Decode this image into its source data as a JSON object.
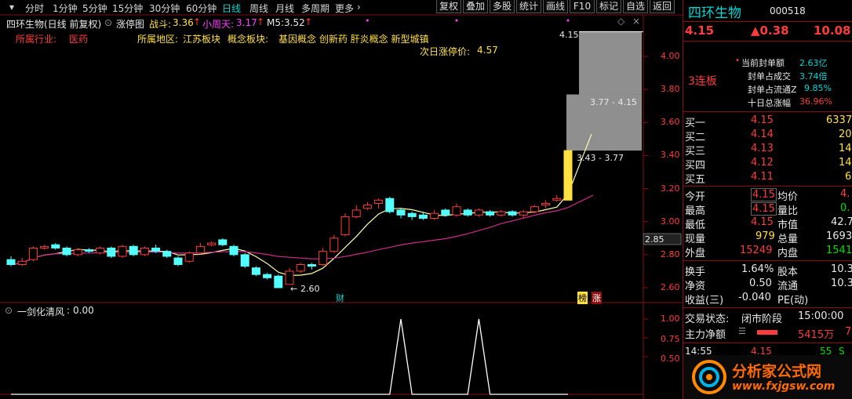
{
  "toolbar": {
    "periods": [
      "分时",
      "1分钟",
      "5分钟",
      "15分钟",
      "30分钟",
      "60分钟",
      "日线",
      "周线",
      "月线",
      "多周期",
      "更多"
    ],
    "active_period": "日线",
    "buttons": [
      "复权",
      "叠加",
      "多股",
      "统计",
      "画线",
      "F10",
      "标记",
      "自选",
      "返回"
    ]
  },
  "info_bar": {
    "stock_title": "四环生物(日线 前复权)",
    "indicator_name": "涨停图",
    "zhandou_label": "战斗:",
    "zhandou_value": "3.36",
    "xiaozhoutian_label": "小周天:",
    "xiaozhoutian_value": "3.17",
    "m5_label": "M5:",
    "m5_value": "3.52"
  },
  "industry": {
    "industry_label": "所属行业:",
    "industry_value": "医药",
    "region_label": "所属地区:",
    "region_value": "江苏板块",
    "concept_label": "概念板块:",
    "concept_value": "基因概念 创新药 肝炎概念 新型城镇",
    "next_limit_label": "次日涨停价:",
    "next_limit_value": "4.57"
  },
  "main_chart": {
    "y_ticks": [
      "4.00",
      "3.80",
      "3.60",
      "3.40",
      "3.20",
      "3.00",
      "2.80",
      "2.60"
    ],
    "price_marker": "2.85",
    "high_label": "4.15",
    "box_upper_label": "3.77 - 4.15",
    "box_lower_label": "3.43 - 3.77",
    "low_label": "2.60",
    "cai_label": "财",
    "bang_label": "榜",
    "zhang_label": "涨",
    "colors": {
      "up": "#ff3c3c",
      "down": "#54ffff",
      "ma_yellow": "#ffffaa",
      "ma_pink": "#d02a8c",
      "box": "#8f8f8f"
    },
    "candles": [
      {
        "o": 2.77,
        "c": 2.74,
        "h": 2.79,
        "l": 2.73
      },
      {
        "o": 2.74,
        "c": 2.76,
        "h": 2.78,
        "l": 2.73
      },
      {
        "o": 2.77,
        "c": 2.84,
        "h": 2.85,
        "l": 2.76
      },
      {
        "o": 2.84,
        "c": 2.85,
        "h": 2.86,
        "l": 2.83
      },
      {
        "o": 2.86,
        "c": 2.84,
        "h": 2.87,
        "l": 2.83
      },
      {
        "o": 2.84,
        "c": 2.8,
        "h": 2.85,
        "l": 2.79
      },
      {
        "o": 2.8,
        "c": 2.83,
        "h": 2.84,
        "l": 2.79
      },
      {
        "o": 2.83,
        "c": 2.82,
        "h": 2.84,
        "l": 2.81
      },
      {
        "o": 2.81,
        "c": 2.84,
        "h": 2.85,
        "l": 2.8
      },
      {
        "o": 2.84,
        "c": 2.79,
        "h": 2.85,
        "l": 2.78
      },
      {
        "o": 2.79,
        "c": 2.85,
        "h": 2.86,
        "l": 2.78
      },
      {
        "o": 2.85,
        "c": 2.8,
        "h": 2.86,
        "l": 2.79
      },
      {
        "o": 2.8,
        "c": 2.84,
        "h": 2.85,
        "l": 2.79
      },
      {
        "o": 2.84,
        "c": 2.82,
        "h": 2.86,
        "l": 2.81
      },
      {
        "o": 2.82,
        "c": 2.79,
        "h": 2.83,
        "l": 2.78
      },
      {
        "o": 2.78,
        "c": 2.74,
        "h": 2.79,
        "l": 2.73
      },
      {
        "o": 2.76,
        "c": 2.81,
        "h": 2.82,
        "l": 2.75
      },
      {
        "o": 2.81,
        "c": 2.85,
        "h": 2.87,
        "l": 2.8
      },
      {
        "o": 2.86,
        "c": 2.87,
        "h": 2.88,
        "l": 2.85
      },
      {
        "o": 2.89,
        "c": 2.86,
        "h": 2.9,
        "l": 2.85
      },
      {
        "o": 2.85,
        "c": 2.8,
        "h": 2.86,
        "l": 2.79
      },
      {
        "o": 2.8,
        "c": 2.73,
        "h": 2.81,
        "l": 2.72
      },
      {
        "o": 2.72,
        "c": 2.68,
        "h": 2.73,
        "l": 2.67
      },
      {
        "o": 2.68,
        "c": 2.66,
        "h": 2.69,
        "l": 2.65
      },
      {
        "o": 2.67,
        "c": 2.6,
        "h": 2.68,
        "l": 2.6
      },
      {
        "o": 2.62,
        "c": 2.7,
        "h": 2.72,
        "l": 2.62
      },
      {
        "o": 2.7,
        "c": 2.74,
        "h": 2.75,
        "l": 2.69
      },
      {
        "o": 2.74,
        "c": 2.73,
        "h": 2.75,
        "l": 2.71
      },
      {
        "o": 2.74,
        "c": 2.82,
        "h": 2.84,
        "l": 2.73
      },
      {
        "o": 2.82,
        "c": 2.9,
        "h": 2.92,
        "l": 2.81
      },
      {
        "o": 2.92,
        "c": 3.03,
        "h": 3.05,
        "l": 2.91
      },
      {
        "o": 3.03,
        "c": 3.07,
        "h": 3.1,
        "l": 3.02
      },
      {
        "o": 3.08,
        "c": 3.1,
        "h": 3.12,
        "l": 3.07
      },
      {
        "o": 3.11,
        "c": 3.13,
        "h": 3.14,
        "l": 3.08
      },
      {
        "o": 3.14,
        "c": 3.06,
        "h": 3.15,
        "l": 3.05
      },
      {
        "o": 3.07,
        "c": 3.04,
        "h": 3.08,
        "l": 3.02
      },
      {
        "o": 3.05,
        "c": 3.03,
        "h": 3.06,
        "l": 3.01
      },
      {
        "o": 3.04,
        "c": 3.02,
        "h": 3.06,
        "l": 3.01
      },
      {
        "o": 3.02,
        "c": 3.05,
        "h": 3.07,
        "l": 3.01
      },
      {
        "o": 3.07,
        "c": 3.04,
        "h": 3.08,
        "l": 3.03
      },
      {
        "o": 3.04,
        "c": 3.09,
        "h": 3.11,
        "l": 3.03
      },
      {
        "o": 3.07,
        "c": 3.04,
        "h": 3.08,
        "l": 3.03
      },
      {
        "o": 3.04,
        "c": 3.07,
        "h": 3.08,
        "l": 3.03
      },
      {
        "o": 3.06,
        "c": 3.04,
        "h": 3.07,
        "l": 3.03
      },
      {
        "o": 3.04,
        "c": 3.06,
        "h": 3.07,
        "l": 3.03
      },
      {
        "o": 3.06,
        "c": 3.04,
        "h": 3.07,
        "l": 3.03
      },
      {
        "o": 3.04,
        "c": 3.06,
        "h": 3.07,
        "l": 3.02
      },
      {
        "o": 3.06,
        "c": 3.09,
        "h": 3.1,
        "l": 3.05
      },
      {
        "o": 3.1,
        "c": 3.11,
        "h": 3.13,
        "l": 3.08
      },
      {
        "o": 3.13,
        "c": 3.14,
        "h": 3.16,
        "l": 3.12
      },
      {
        "o": 3.13,
        "c": 3.43,
        "h": 3.43,
        "l": 3.13
      }
    ],
    "zt_dots": [
      32,
      40,
      50
    ]
  },
  "sub_chart": {
    "name": "一剑化清风",
    "value": "0.00",
    "y_ticks": [
      "1.00",
      "0.75",
      "0.50"
    ],
    "signal_values": [
      0,
      0,
      0,
      0,
      0,
      0,
      0,
      0,
      0,
      0,
      0,
      0,
      0,
      0,
      0,
      0,
      0,
      0,
      0,
      0,
      0,
      0,
      0,
      0,
      0,
      0,
      0,
      0,
      0,
      0,
      0,
      0,
      0,
      0,
      0,
      1,
      0,
      0,
      0,
      0,
      0,
      0,
      1,
      0,
      0,
      0,
      0,
      0,
      0,
      0,
      0
    ]
  },
  "quote": {
    "stock_name": "四环生物",
    "stock_code": "000518",
    "price": "4.15",
    "change": "▲0.38",
    "change_pct": "10.08",
    "tag": "3连板",
    "seal": [
      {
        "label": "当前封单额",
        "value": "2.63亿"
      },
      {
        "label": "封单占成交",
        "value": "3.74倍"
      },
      {
        "label": "封单占流通Z",
        "value": "9.85%"
      },
      {
        "label": "十日总涨幅",
        "value": "36.96%"
      }
    ],
    "bids": [
      {
        "label": "买一",
        "price": "4.15",
        "vol": "6337"
      },
      {
        "label": "买二",
        "price": "4.14",
        "vol": "20"
      },
      {
        "label": "买三",
        "price": "4.13",
        "vol": "14"
      },
      {
        "label": "买四",
        "price": "4.12",
        "vol": "14"
      },
      {
        "label": "买五",
        "price": "4.11",
        "vol": "6"
      }
    ],
    "stats": [
      {
        "l1": "今开",
        "v1": "4.15",
        "l2": "均价",
        "v2": "4."
      },
      {
        "l1": "最高",
        "v1": "4.15",
        "l2": "量比",
        "v2": "0."
      },
      {
        "l1": "最低",
        "v1": "4.15",
        "l2": "市值",
        "v2": "42.7"
      },
      {
        "l1": "现量",
        "v1": "979",
        "l2": "总量",
        "v2": "1693"
      },
      {
        "l1": "外盘",
        "v1": "15249",
        "l2": "内盘",
        "v2": "1541"
      }
    ],
    "stats2": [
      {
        "l1": "换手",
        "v1": "1.64%",
        "l2": "股本",
        "v2": "10.3"
      },
      {
        "l1": "净资",
        "v1": "0.50",
        "l2": "流通",
        "v2": "10.3"
      },
      {
        "l1": "收益(三)",
        "v1": "-0.040",
        "l2": "PE(动)",
        "v2": ""
      }
    ],
    "trade_status_label": "交易状态:",
    "trade_status_value": "闭市阶段",
    "trade_time": "15:00:00",
    "capital_label": "主力净额",
    "capital_value": "5415万",
    "capital_extra": "7",
    "tick": {
      "time": "14:55",
      "price": "4.15",
      "vol": "55",
      "dir": "S"
    }
  },
  "watermark": {
    "name": "分析家公式网",
    "url": "www.fxjgsw.com"
  }
}
